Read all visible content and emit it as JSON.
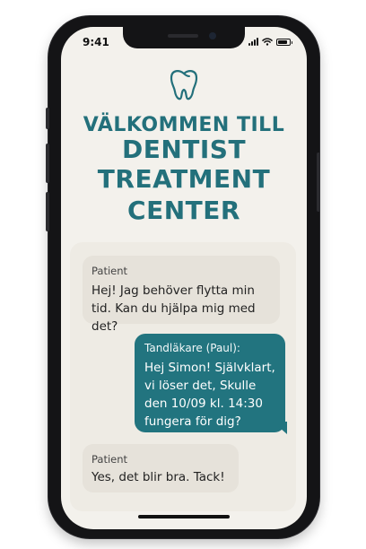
{
  "status_bar": {
    "time": "9:41"
  },
  "header": {
    "icon": "tooth-icon",
    "line1": "VÄLKOMMEN TILL",
    "line2": "DENTIST",
    "line3": "TREATMENT",
    "line4": "CENTER"
  },
  "chat": {
    "messages": [
      {
        "sender": "Patient",
        "text": "Hej! Jag behöver flytta min tid. Kan du hjälpa mig med det?",
        "side": "left"
      },
      {
        "sender": "Tandläkare (Paul):",
        "text": "Hej Simon! Självklart, vi löser det, Skulle den 10/09 kl. 14:30 fungera för dig?",
        "side": "right"
      },
      {
        "sender": "Patient",
        "text": "Yes, det blir bra. Tack!",
        "side": "left"
      }
    ]
  },
  "colors": {
    "accent": "#23707b",
    "bubble_right": "#22747f",
    "bubble_left": "#e6e2da",
    "screen_bg": "#f3f1ec"
  }
}
